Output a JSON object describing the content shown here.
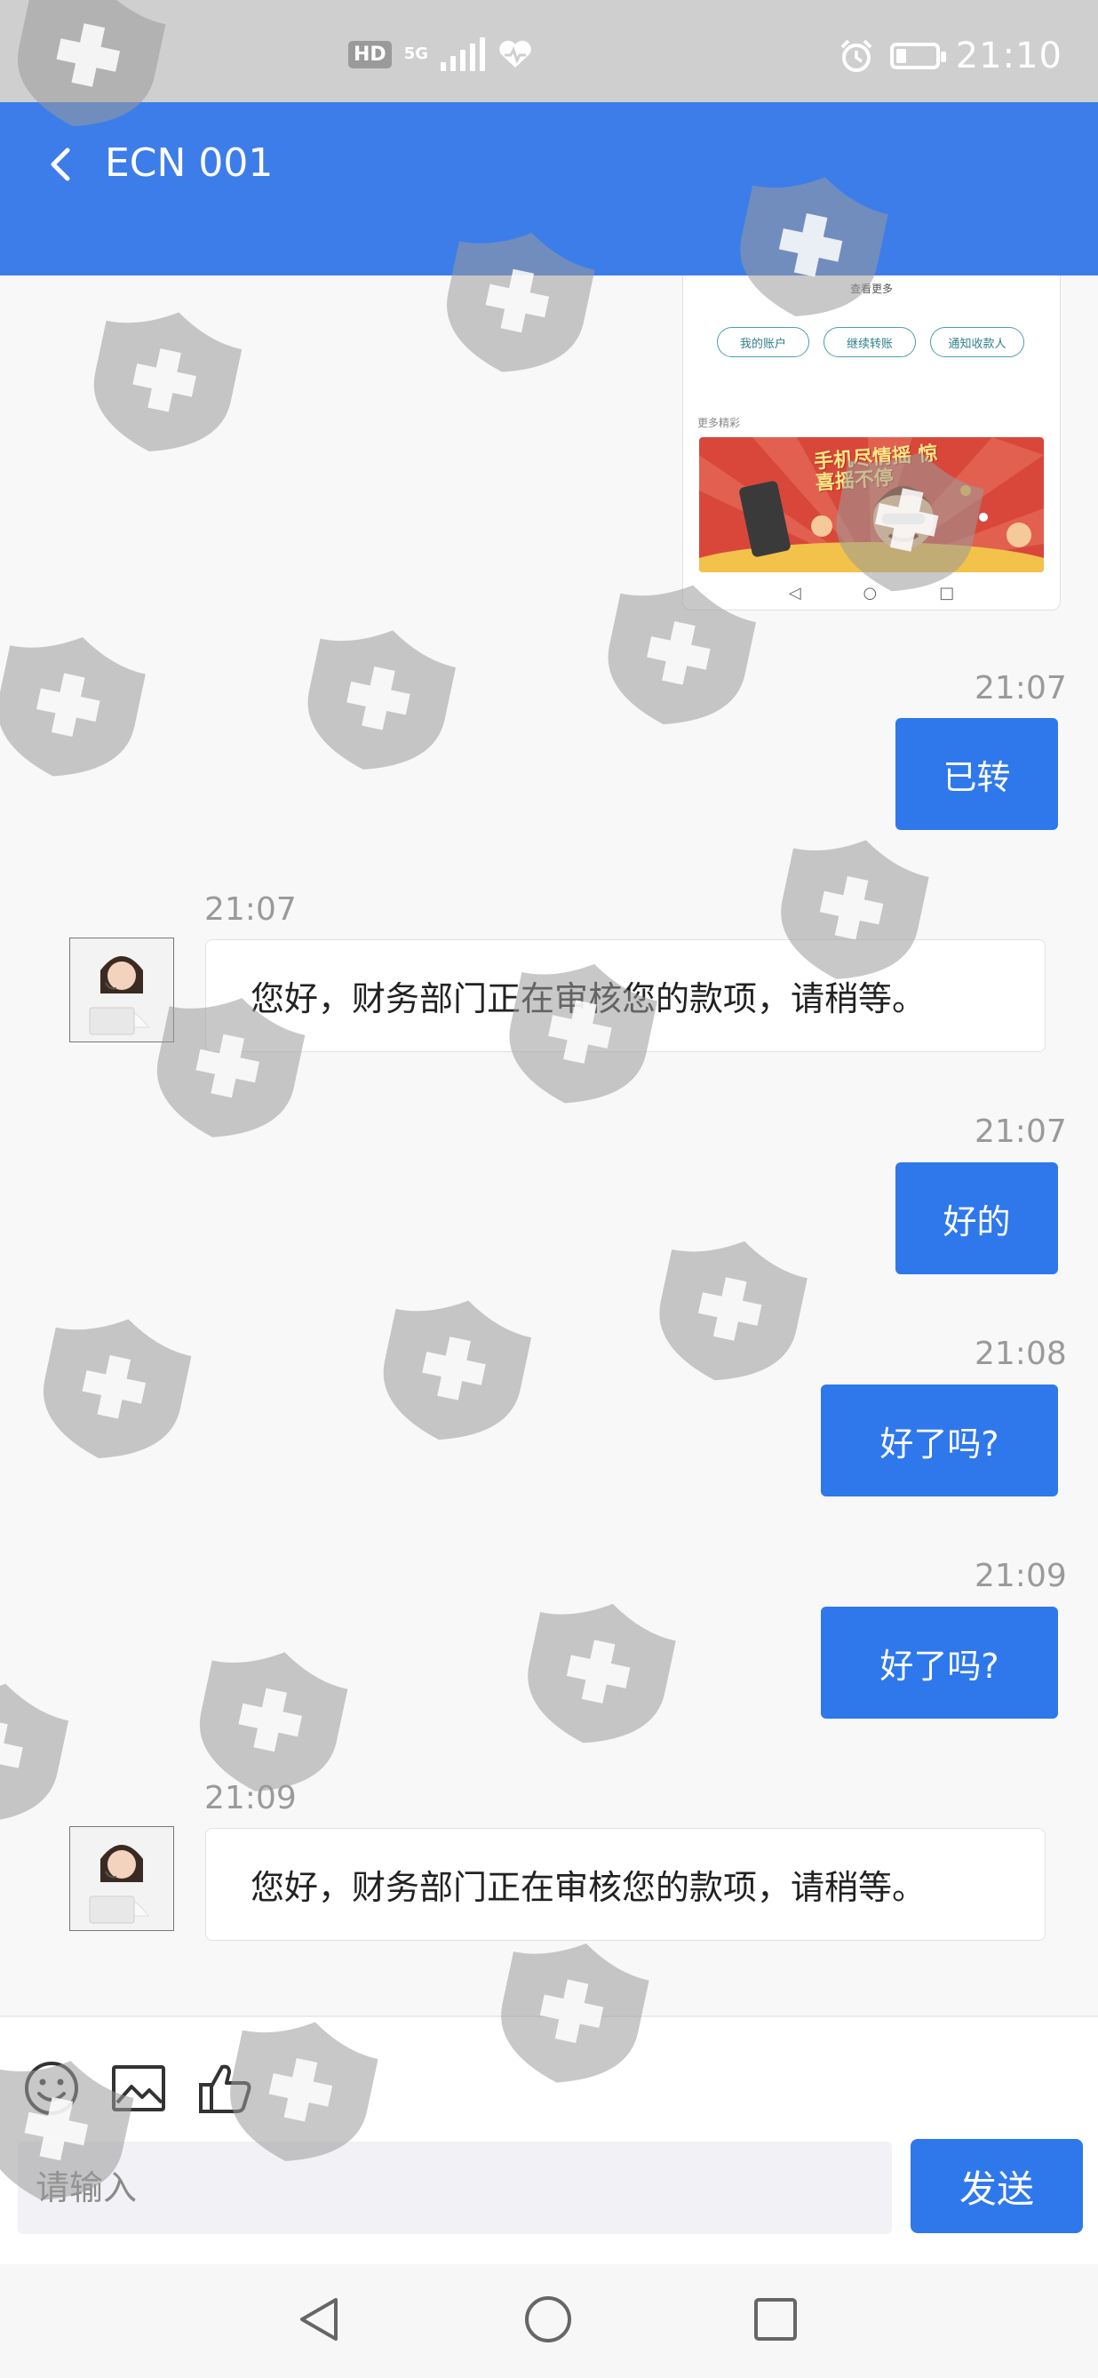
{
  "status_bar": {
    "hd": "HD",
    "network": "5G",
    "time": "21:10"
  },
  "header": {
    "title": "ECN 001"
  },
  "shared_screenshot": {
    "see_more": "查看更多",
    "buttons": [
      "我的账户",
      "继续转账",
      "通知收款人"
    ],
    "more_label": "更多精彩",
    "banner_text": "手机尽情摇 惊喜摇不停"
  },
  "messages": [
    {
      "time": "21:07",
      "text": "已转",
      "direction": "out"
    },
    {
      "time": "21:07",
      "text": "您好，财务部门正在审核您的款项，请稍等。",
      "direction": "in"
    },
    {
      "time": "21:07",
      "text": "好的",
      "direction": "out"
    },
    {
      "time": "21:08",
      "text": "好了吗?",
      "direction": "out"
    },
    {
      "time": "21:09",
      "text": "好了吗?",
      "direction": "out"
    },
    {
      "time": "21:09",
      "text": "您好，财务部门正在审核您的款项，请稍等。",
      "direction": "in"
    }
  ],
  "composer": {
    "placeholder": "请输入",
    "send_label": "发送"
  },
  "colors": {
    "brand": "#3d7de9",
    "bubble_out": "#2f78ec",
    "status_bar": "#cfcfcf"
  },
  "icons": [
    "back-icon",
    "emoji-icon",
    "image-icon",
    "thumbs-up-icon",
    "nav-back-icon",
    "nav-home-icon",
    "nav-recents-icon",
    "shield-plus-watermark-icon"
  ]
}
